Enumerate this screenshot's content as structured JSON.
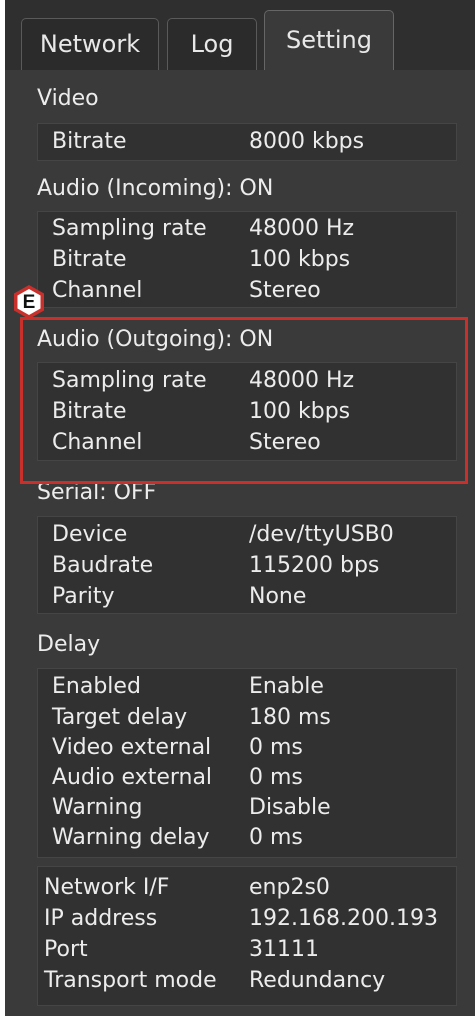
{
  "tabs": [
    {
      "label": "Network",
      "active": false
    },
    {
      "label": "Log",
      "active": false
    },
    {
      "label": "Setting",
      "active": true
    }
  ],
  "video": {
    "title": "Video",
    "rows": [
      {
        "key": "Bitrate",
        "value": "8000 kbps"
      }
    ]
  },
  "audio_in": {
    "title": "Audio (Incoming): ON",
    "rows": [
      {
        "key": "Sampling rate",
        "value": "48000 Hz"
      },
      {
        "key": "Bitrate",
        "value": "100 kbps"
      },
      {
        "key": "Channel",
        "value": "Stereo"
      }
    ]
  },
  "annotation": {
    "label": "E",
    "color": "#c9302c"
  },
  "audio_out": {
    "title": "Audio (Outgoing): ON",
    "rows": [
      {
        "key": "Sampling rate",
        "value": "48000 Hz"
      },
      {
        "key": "Bitrate",
        "value": "100 kbps"
      },
      {
        "key": "Channel",
        "value": "Stereo"
      }
    ]
  },
  "serial": {
    "title": "Serial: OFF",
    "rows": [
      {
        "key": "Device",
        "value": "/dev/ttyUSB0"
      },
      {
        "key": "Baudrate",
        "value": "115200 bps"
      },
      {
        "key": "Parity",
        "value": "None"
      }
    ]
  },
  "delay": {
    "title": "Delay",
    "rows": [
      {
        "key": "Enabled",
        "value": "Enable"
      },
      {
        "key": "Target delay",
        "value": "180 ms"
      },
      {
        "key": "Video external",
        "value": "0 ms"
      },
      {
        "key": "Audio external",
        "value": "0 ms"
      },
      {
        "key": "Warning",
        "value": "Disable"
      },
      {
        "key": "Warning delay",
        "value": "0 ms"
      }
    ]
  },
  "network": {
    "rows": [
      {
        "key": "Network I/F",
        "value": "enp2s0"
      },
      {
        "key": "IP address",
        "value": "192.168.200.193"
      },
      {
        "key": "Port",
        "value": "31111"
      },
      {
        "key": "Transport mode",
        "value": "Redundancy"
      }
    ]
  },
  "colors": {
    "panel": "#3a3a3a",
    "group": "#313131",
    "text": "#ececec",
    "highlight": "#c9302c"
  }
}
